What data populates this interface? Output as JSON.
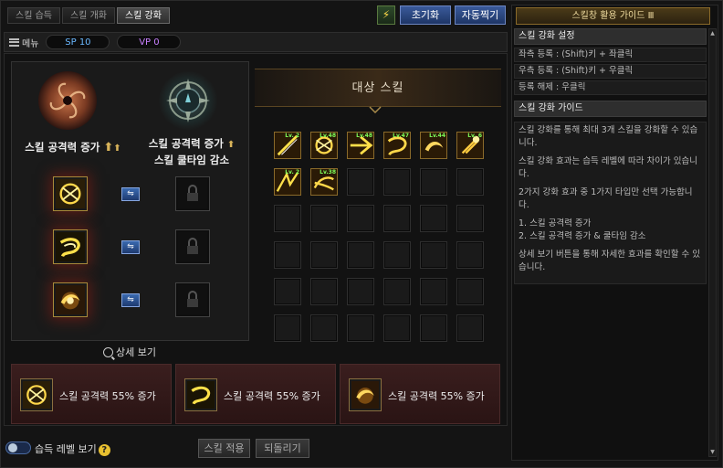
{
  "tabs": [
    {
      "label": "스킬 습득"
    },
    {
      "label": "스킬 개화"
    },
    {
      "label": "스킬 강화"
    }
  ],
  "toolbar": {
    "reset_label": "초기화",
    "auto_label": "자동찍기",
    "auto_icon": "auto-skill-icon"
  },
  "menubar": {
    "menu_label": "메뉴",
    "sp": "SP 10",
    "vp": "VP 0"
  },
  "left": {
    "option1": {
      "label": "스킬 공격력 증가"
    },
    "option2": {
      "line1": "스킬 공격력 증가",
      "line2": "스킬 쿨타임 감소"
    },
    "swap_glyph": "⇋"
  },
  "target": {
    "title": "대상 스킬"
  },
  "skills": [
    {
      "lv": "Lv. 2"
    },
    {
      "lv": "Lv.48"
    },
    {
      "lv": "Lv.48"
    },
    {
      "lv": "Lv.47"
    },
    {
      "lv": "Lv.44"
    },
    {
      "lv": "Lv. 6"
    },
    {
      "lv": "Lv. 2"
    },
    {
      "lv": "Lv.38"
    }
  ],
  "detail": {
    "label": "상세 보기"
  },
  "cards": [
    {
      "text": "스킬 공격력 55% 증가"
    },
    {
      "text": "스킬 공격력 55% 증가"
    },
    {
      "text": "스킬 공격력 55% 증가"
    }
  ],
  "bottom": {
    "toggle_label": "습득 레벨 보기",
    "help": "?",
    "apply_label": "스킬 적용",
    "revert_label": "되돌리기"
  },
  "guide": {
    "title": "스킬창 활용 가이드 Ⅲ",
    "section1": "스킬 강화 설정",
    "rows": [
      "좌측 등록 : (Shift)키 + 좌클릭",
      "우측 등록 : (Shift)키 + 우클릭",
      "등록 해제 : 우클릭"
    ],
    "section2": "스킬 강화 가이드",
    "p1": "스킬 강화를 통해 최대 3개 스킬을 강화할 수 있습니다.",
    "p2": "스킬 강화 효과는 습득 레벨에 따라 차이가 있습니다.",
    "p3": "2가지 강화 효과 중 1가지 타입만 선택 가능합니다.",
    "p4a": "1. 스킬 공격력 증가",
    "p4b": "2. 스킬 공격력 증가 & 쿨타임 감소",
    "p5": "상세 보기 버튼을 통해 자세한 효과를 확인할 수 있습니다."
  },
  "colors": {
    "accent": "#d9b45a",
    "sp": "#6ab8ff",
    "vp": "#c880ff",
    "level": "#7fff5a"
  }
}
